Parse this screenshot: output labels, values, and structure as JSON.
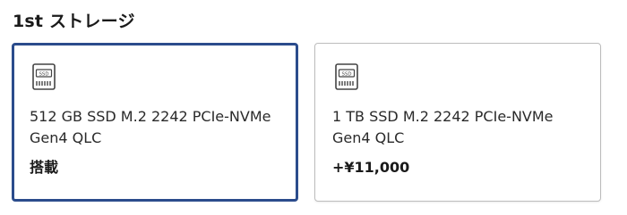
{
  "section": {
    "title": "1st ストレージ"
  },
  "options": [
    {
      "icon": "ssd-icon",
      "icon_text": "SSD",
      "name": "512 GB SSD M.2 2242 PCIe-NVMe Gen4 QLC",
      "price": "搭載",
      "selected": true
    },
    {
      "icon": "ssd-icon",
      "icon_text": "SSD",
      "name": "1 TB SSD M.2 2242 PCIe-NVMe Gen4 QLC",
      "price": "+¥11,000",
      "selected": false
    }
  ],
  "colors": {
    "selected_border": "#2b4c8c",
    "unselected_border": "#bdbdbd"
  }
}
